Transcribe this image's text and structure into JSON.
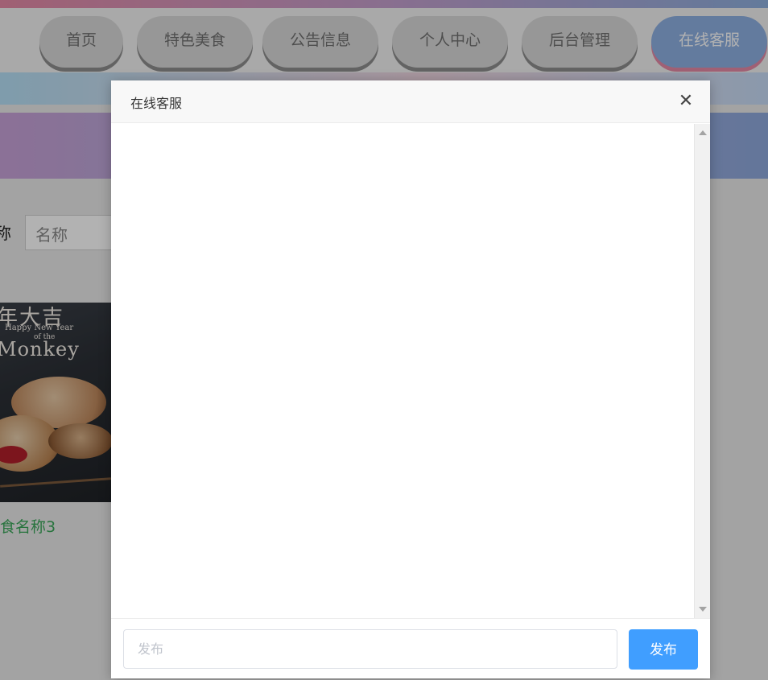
{
  "nav": {
    "items": [
      {
        "label": "首页"
      },
      {
        "label": "特色美食"
      },
      {
        "label": "公告信息"
      },
      {
        "label": "个人中心"
      },
      {
        "label": "后台管理"
      },
      {
        "label": "在线客服",
        "active": true
      }
    ]
  },
  "search": {
    "label": "称",
    "placeholder": "名称"
  },
  "product": {
    "image_text": [
      "年大吉",
      "Happy New Year",
      "of the",
      "Monkey"
    ],
    "name": "食名称3"
  },
  "modal": {
    "title": "在线客服",
    "close_icon": "close-icon",
    "input_placeholder": "发布",
    "send_label": "发布"
  },
  "colors": {
    "accent": "#409eff",
    "nav_active": "#8fb0e3",
    "food_name": "#3aa659"
  }
}
